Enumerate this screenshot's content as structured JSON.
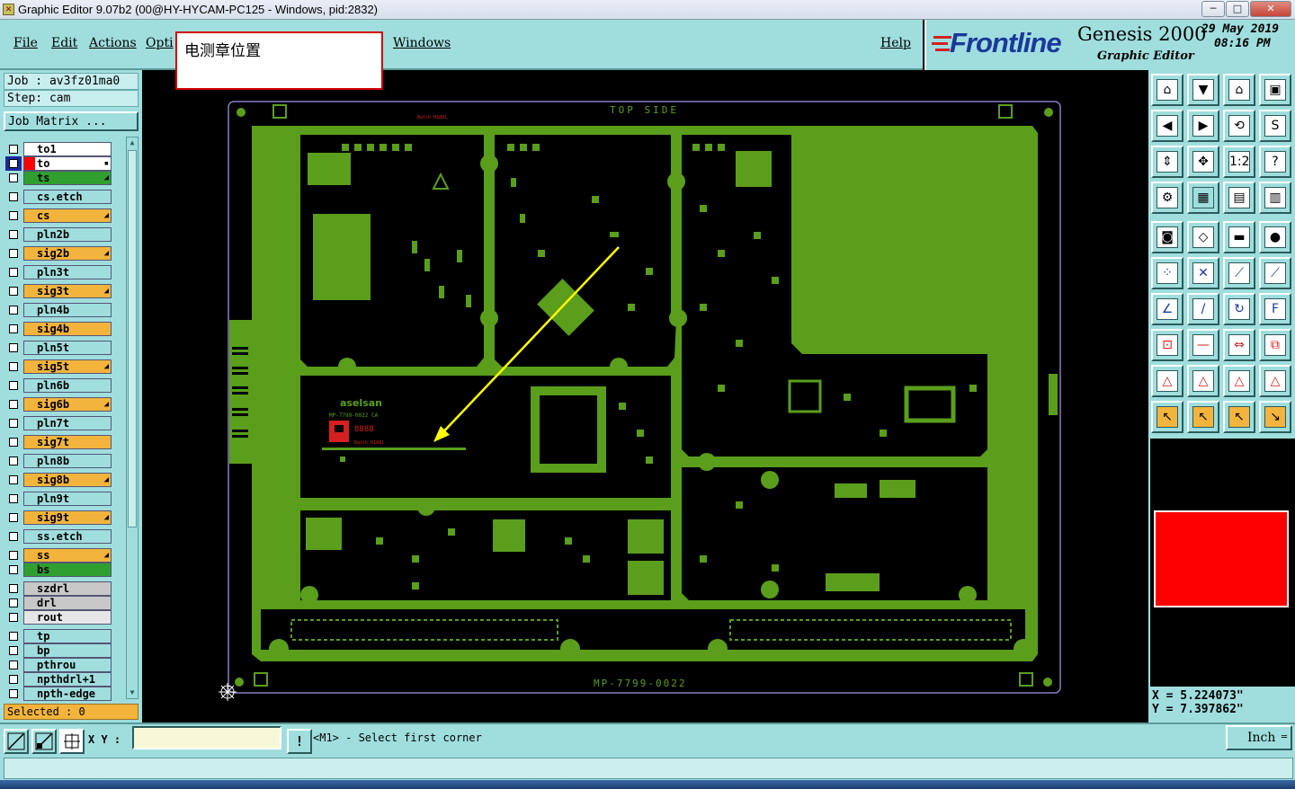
{
  "window": {
    "title": "Graphic Editor 9.07b2 (00@HY-HYCAM-PC125 - Windows, pid:2832)",
    "min": "─",
    "max": "□",
    "close": "✕"
  },
  "menu": {
    "file": "File",
    "edit": "Edit",
    "actions": "Actions",
    "options": "Opti",
    "windows": "Windows",
    "help": "Help"
  },
  "logo": {
    "brand": "Frontline",
    "product": "Genesis 2000",
    "subtitle": "Graphic Editor",
    "date": "29 May 2019",
    "time": "08:16 PM"
  },
  "popup": {
    "text": "电测章位置"
  },
  "job": {
    "job_label": "Job : av3fz01ma0",
    "step_label": "Step: cam",
    "matrix_button": "Job Matrix ..."
  },
  "layers": [
    {
      "name": "to1",
      "color": "#ffffff",
      "arrow": ""
    },
    {
      "name": "to",
      "color": "#ffffff",
      "arrow": "▪",
      "active": true
    },
    {
      "name": "ts",
      "color": "#2fa02f",
      "arrow": "◢"
    },
    {
      "name": "cs.etch",
      "color": "#a0dede",
      "arrow": ""
    },
    {
      "name": "cs",
      "color": "#f2b43c",
      "arrow": "◢"
    },
    {
      "name": "pln2b",
      "color": "#a0dede",
      "arrow": ""
    },
    {
      "name": "sig2b",
      "color": "#f2b43c",
      "arrow": "◢"
    },
    {
      "name": "pln3t",
      "color": "#a0dede",
      "arrow": ""
    },
    {
      "name": "sig3t",
      "color": "#f2b43c",
      "arrow": "◢"
    },
    {
      "name": "pln4b",
      "color": "#a0dede",
      "arrow": ""
    },
    {
      "name": "sig4b",
      "color": "#f2b43c",
      "arrow": ""
    },
    {
      "name": "pln5t",
      "color": "#a0dede",
      "arrow": ""
    },
    {
      "name": "sig5t",
      "color": "#f2b43c",
      "arrow": "◢"
    },
    {
      "name": "pln6b",
      "color": "#a0dede",
      "arrow": ""
    },
    {
      "name": "sig6b",
      "color": "#f2b43c",
      "arrow": "◢"
    },
    {
      "name": "pln7t",
      "color": "#a0dede",
      "arrow": ""
    },
    {
      "name": "sig7t",
      "color": "#f2b43c",
      "arrow": ""
    },
    {
      "name": "pln8b",
      "color": "#a0dede",
      "arrow": ""
    },
    {
      "name": "sig8b",
      "color": "#f2b43c",
      "arrow": "◢"
    },
    {
      "name": "pln9t",
      "color": "#a0dede",
      "arrow": ""
    },
    {
      "name": "sig9t",
      "color": "#f2b43c",
      "arrow": "◢"
    },
    {
      "name": "ss.etch",
      "color": "#a0dede",
      "arrow": ""
    },
    {
      "name": "ss",
      "color": "#f2b43c",
      "arrow": "◢"
    },
    {
      "name": "bs",
      "color": "#2fa02f",
      "arrow": ""
    },
    {
      "name": "szdrl",
      "color": "#c8c8c8",
      "arrow": ""
    },
    {
      "name": "drl",
      "color": "#c8c8c8",
      "arrow": ""
    },
    {
      "name": "rout",
      "color": "#e6e6e6",
      "arrow": ""
    },
    {
      "name": "tp",
      "color": "#a0dede",
      "arrow": ""
    },
    {
      "name": "bp",
      "color": "#a0dede",
      "arrow": ""
    },
    {
      "name": "pthrou",
      "color": "#a0dede",
      "arrow": ""
    },
    {
      "name": "npthdrl+1",
      "color": "#a0dede",
      "arrow": ""
    },
    {
      "name": "npth-edge",
      "color": "#a0dede",
      "arrow": ""
    }
  ],
  "selected": "Selected : 0",
  "board": {
    "top_label": "TOP SIDE",
    "bottom_label": "MP-7799-0022",
    "batch_top": "Batch H1881",
    "batch_mark": "Batch H1881",
    "mark_brand": "aselsan",
    "mark_part": "MP-7799-0022 CA",
    "mark_code": "8888"
  },
  "coords": {
    "x": "X = 5.224073\"",
    "y": "Y = 7.397862\""
  },
  "status": {
    "xy_label": "X Y :",
    "xy_value": "",
    "alert": "!",
    "message": "<M1> - Select first corner",
    "unit": "Inch"
  },
  "colors": {
    "panel": "#a0dede",
    "board": "#5a9e1c",
    "highlight": "#f2b43c",
    "arrow": "#ffff00",
    "preview": "#ff0000"
  },
  "tools": [
    "zoom-home-icon",
    "zoom-down-icon",
    "house-icon",
    "window-icon",
    "pan-left-icon",
    "pan-right-icon",
    "mirror-icon",
    "s-curve-icon",
    "fit-icon",
    "zoom-fit-icon",
    "ratio-icon",
    "help-icon",
    "measure-icon",
    "grid-icon",
    "layers-red-icon",
    "layers-select-icon",
    "pad-icon",
    "draw-shape-icon",
    "ruler-icon",
    "circle-icon",
    "net-icon",
    "cross-icon",
    "line-point-icon",
    "line-point2-icon",
    "angle-icon",
    "slash-icon",
    "rotate-icon",
    "symbol-icon",
    "move-icon",
    "line-icon",
    "align-icon",
    "copy-icon",
    "triangle-icon",
    "triangle2-icon",
    "triangle3-icon",
    "triangle4-icon",
    "select-icon",
    "select2-icon",
    "select3-icon",
    "select4-icon"
  ]
}
